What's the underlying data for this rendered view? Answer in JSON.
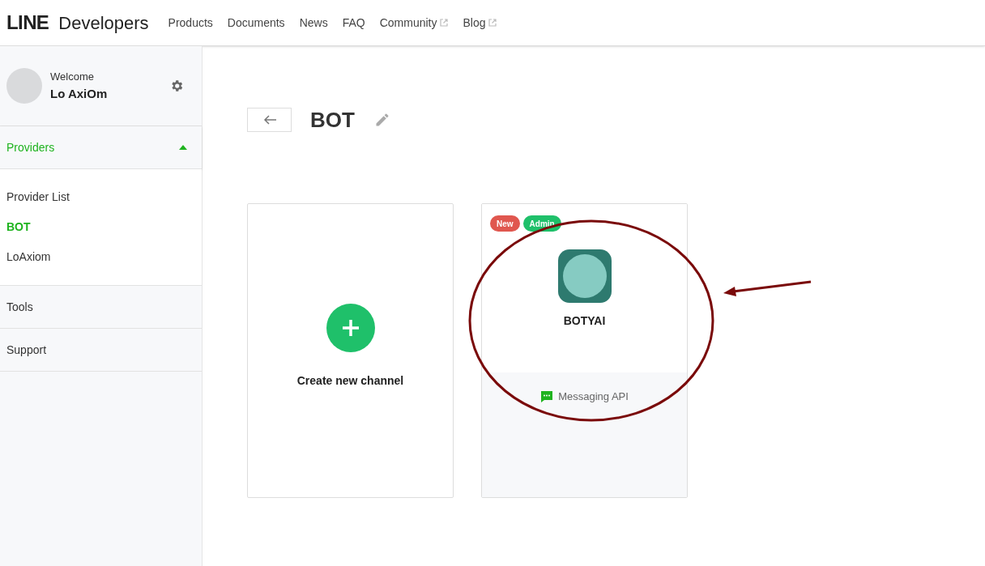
{
  "header": {
    "logo": "LINE",
    "brand": "Developers",
    "nav": [
      {
        "label": "Products",
        "external": false
      },
      {
        "label": "Documents",
        "external": false
      },
      {
        "label": "News",
        "external": false
      },
      {
        "label": "FAQ",
        "external": false
      },
      {
        "label": "Community",
        "external": true
      },
      {
        "label": "Blog",
        "external": true
      }
    ]
  },
  "sidebar": {
    "welcome": "Welcome",
    "user": "Lo AxiOm",
    "sections": [
      {
        "label": "Providers",
        "expanded": true,
        "children": [
          {
            "label": "Provider List",
            "selected": false
          },
          {
            "label": "BOT",
            "selected": true
          },
          {
            "label": "LoAxiom",
            "selected": false
          }
        ]
      },
      {
        "label": "Tools",
        "expanded": false
      },
      {
        "label": "Support",
        "expanded": false
      }
    ]
  },
  "main": {
    "title": "BOT",
    "create_label": "Create new channel",
    "channels": [
      {
        "name": "BOTYAI",
        "type": "Messaging API",
        "badges": [
          {
            "label": "New",
            "color": "#e0574f"
          },
          {
            "label": "Admin",
            "color": "#1fc06a"
          }
        ]
      }
    ]
  }
}
